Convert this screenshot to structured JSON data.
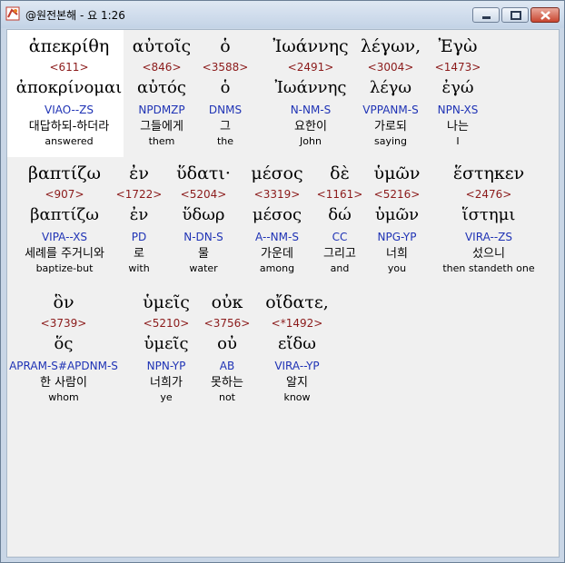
{
  "window": {
    "title": "@원전본해 - 요 1:26",
    "controls": [
      "minimize-icon",
      "maximize-icon",
      "close-icon"
    ]
  },
  "words": [
    {
      "greek": "ἀπεκρίθη",
      "strong": "<611>",
      "lemma": "ἀποκρίνομαι",
      "parsing": "VIAO--ZS",
      "korean": "대답하되-하더라",
      "english": "answered",
      "selected": true
    },
    {
      "greek": "αὐτοῖς",
      "strong": "<846>",
      "lemma": "αὐτός",
      "parsing": "NPDMZP",
      "korean": "그들에게",
      "english": "them"
    },
    {
      "greek": "ὁ",
      "strong": "<3588>",
      "lemma": "ὁ",
      "parsing": "DNMS",
      "korean": "그",
      "english": "the"
    },
    {
      "greek": "Ἰωάννης",
      "strong": "<2491>",
      "lemma": "Ἰωάννης",
      "parsing": "N-NM-S",
      "korean": "요한이",
      "english": "John"
    },
    {
      "greek": "λέγων,",
      "strong": "<3004>",
      "lemma": "λέγω",
      "parsing": "VPPANM-S",
      "korean": "가로되",
      "english": "saying"
    },
    {
      "greek": "Ἐγὼ",
      "strong": "<1473>",
      "lemma": "ἐγώ",
      "parsing": "NPN-XS",
      "korean": "나는",
      "english": "I"
    },
    {
      "greek": "βαπτίζω",
      "strong": "<907>",
      "lemma": "βαπτίζω",
      "parsing": "VIPA--XS",
      "korean": "세례를 주거니와",
      "english": "baptize-but"
    },
    {
      "greek": "ἐν",
      "strong": "<1722>",
      "lemma": "ἐν",
      "parsing": "PD",
      "korean": "로",
      "english": "with"
    },
    {
      "greek": "ὕδατι·",
      "strong": "<5204>",
      "lemma": "ὕδωρ",
      "parsing": "N-DN-S",
      "korean": "물",
      "english": "water"
    },
    {
      "greek": "μέσος",
      "strong": "<3319>",
      "lemma": "μέσος",
      "parsing": "A--NM-S",
      "korean": "가운데",
      "english": "among"
    },
    {
      "greek": "δὲ",
      "strong": "<1161>",
      "lemma": "δώ",
      "parsing": "CC",
      "korean": "그리고",
      "english": "and"
    },
    {
      "greek": "ὑμῶν",
      "strong": "<5216>",
      "lemma": "ὑμῶν",
      "parsing": "NPG-YP",
      "korean": "너희",
      "english": "you"
    },
    {
      "greek": "ἕστηκεν",
      "strong": "<2476>",
      "lemma": "ἵστημι",
      "parsing": "VIRA--ZS",
      "korean": "섰으니",
      "english": "then standeth one"
    },
    {
      "greek": "ὃν",
      "strong": "<3739>",
      "lemma": "ὅς",
      "parsing": "APRAM-S#APDNM-S",
      "korean": "한 사람이",
      "english": "whom"
    },
    {
      "greek": "ὑμεῖς",
      "strong": "<5210>",
      "lemma": "ὑμεῖς",
      "parsing": "NPN-YP",
      "korean": "너희가",
      "english": "ye"
    },
    {
      "greek": "οὐκ",
      "strong": "<3756>",
      "lemma": "οὐ",
      "parsing": "AB",
      "korean": "못하는",
      "english": "not"
    },
    {
      "greek": "οἴδατε,",
      "strong": "<*1492>",
      "lemma": "εἴδω",
      "parsing": "VIRA--YP",
      "korean": "알지",
      "english": "know"
    }
  ]
}
